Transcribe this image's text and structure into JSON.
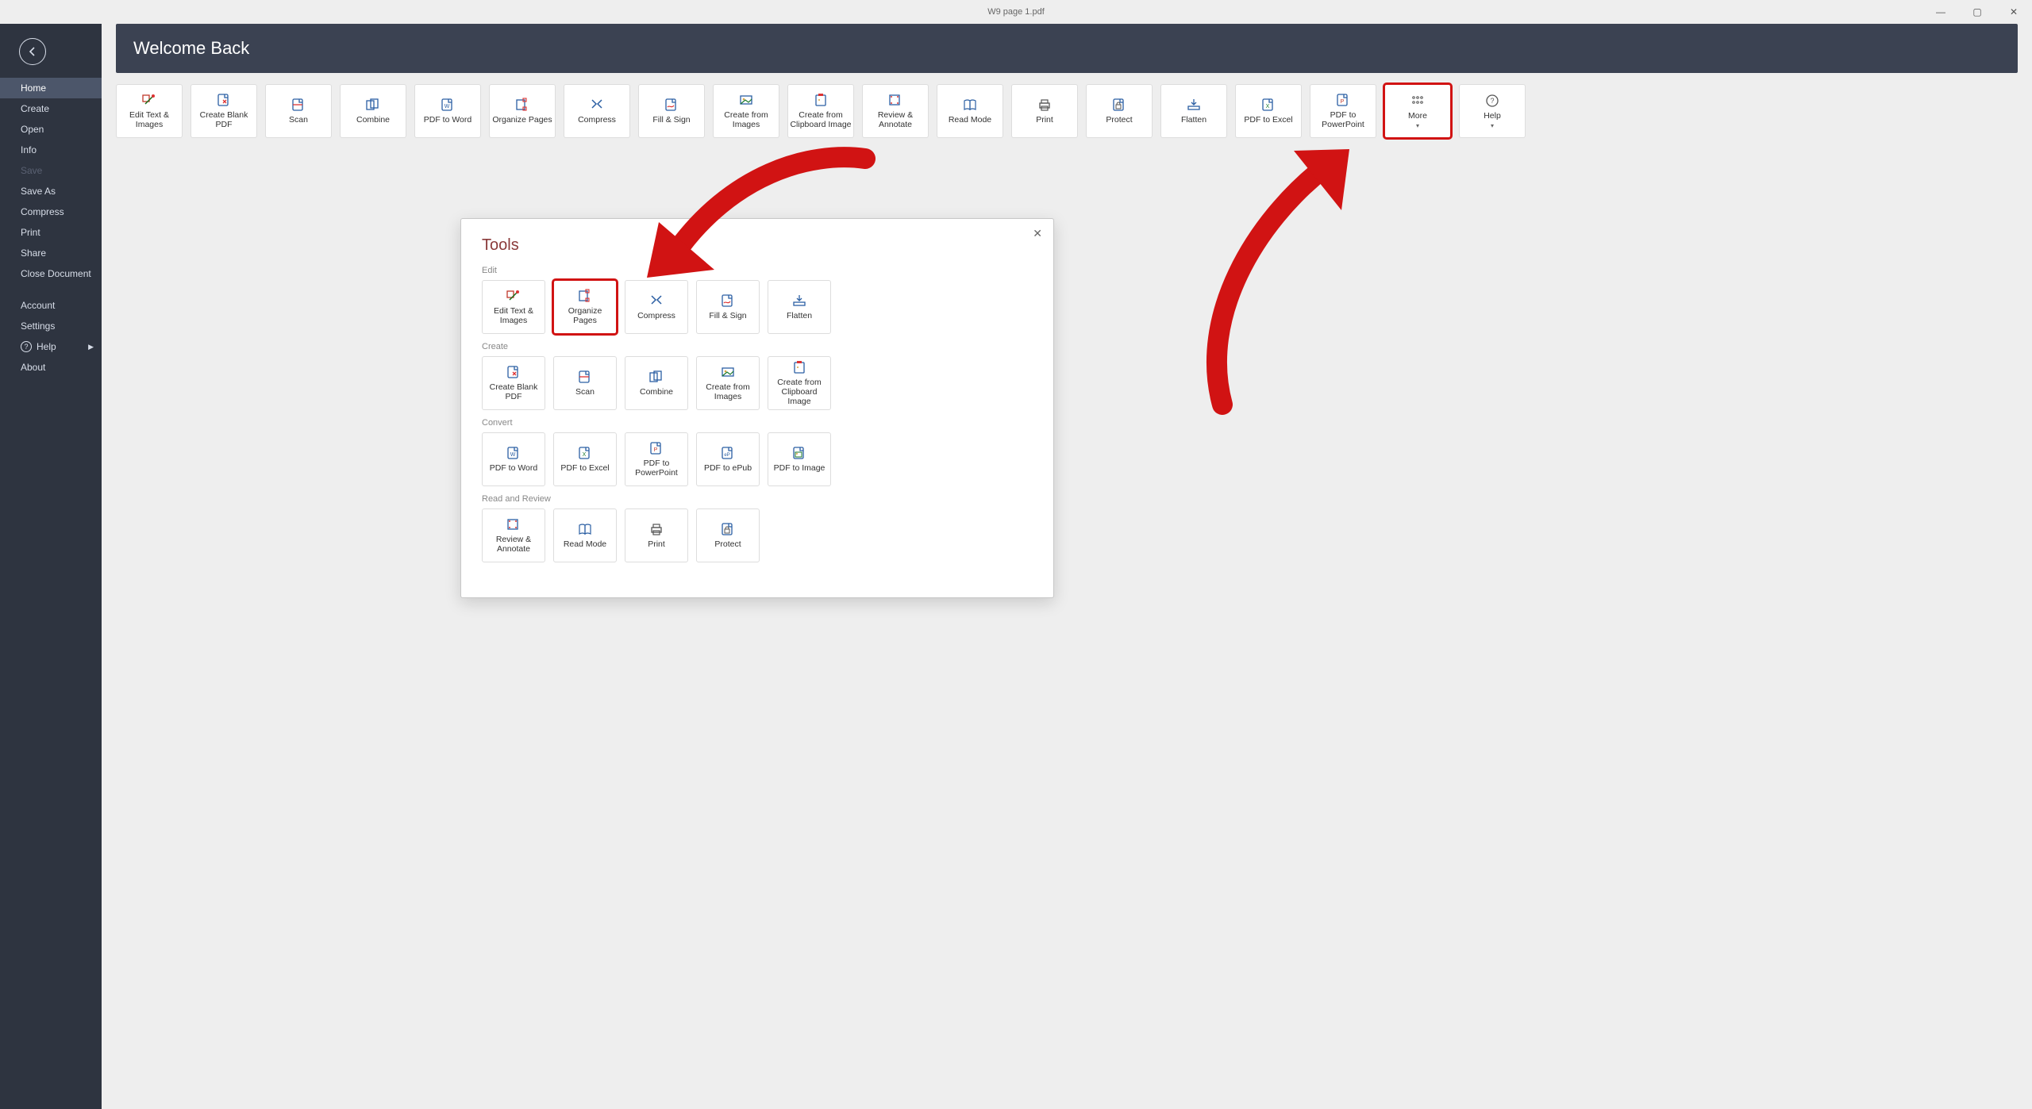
{
  "titlebar": {
    "document_title": "W9 page 1.pdf"
  },
  "window_controls": {
    "minimize": "—",
    "maximize": "▢",
    "close": "✕"
  },
  "sidebar": {
    "items": [
      {
        "label": "Home",
        "active": true
      },
      {
        "label": "Create"
      },
      {
        "label": "Open"
      },
      {
        "label": "Info"
      },
      {
        "label": "Save",
        "disabled": true
      },
      {
        "label": "Save As"
      },
      {
        "label": "Compress"
      },
      {
        "label": "Print"
      },
      {
        "label": "Share"
      },
      {
        "label": "Close Document"
      }
    ],
    "footer": [
      {
        "label": "Account"
      },
      {
        "label": "Settings"
      },
      {
        "label": "Help",
        "has_help_icon": true,
        "has_submenu": true
      },
      {
        "label": "About"
      }
    ]
  },
  "banner": {
    "title": "Welcome Back"
  },
  "toolbar": {
    "tiles": [
      {
        "label": "Edit Text & Images",
        "icon": "edit-text-images-icon"
      },
      {
        "label": "Create Blank PDF",
        "icon": "create-blank-pdf-icon"
      },
      {
        "label": "Scan",
        "icon": "scan-icon"
      },
      {
        "label": "Combine",
        "icon": "combine-icon"
      },
      {
        "label": "PDF to Word",
        "icon": "pdf-to-word-icon"
      },
      {
        "label": "Organize Pages",
        "icon": "organize-pages-icon"
      },
      {
        "label": "Compress",
        "icon": "compress-icon"
      },
      {
        "label": "Fill & Sign",
        "icon": "fill-sign-icon"
      },
      {
        "label": "Create from Images",
        "icon": "create-from-images-icon"
      },
      {
        "label": "Create from Clipboard Image",
        "icon": "create-from-clipboard-icon"
      },
      {
        "label": "Review & Annotate",
        "icon": "review-annotate-icon"
      },
      {
        "label": "Read Mode",
        "icon": "read-mode-icon"
      },
      {
        "label": "Print",
        "icon": "print-icon"
      },
      {
        "label": "Protect",
        "icon": "protect-icon"
      },
      {
        "label": "Flatten",
        "icon": "flatten-icon"
      },
      {
        "label": "PDF to Excel",
        "icon": "pdf-to-excel-icon"
      },
      {
        "label": "PDF to PowerPoint",
        "icon": "pdf-to-powerpoint-icon"
      },
      {
        "label": "More",
        "icon": "more-icon",
        "dropdown": true,
        "highlight": true
      },
      {
        "label": "Help",
        "icon": "help-icon",
        "dropdown": true
      }
    ]
  },
  "dialog": {
    "title": "Tools",
    "sections": [
      {
        "label": "Edit",
        "tiles": [
          {
            "label": "Edit Text & Images",
            "icon": "edit-text-images-icon"
          },
          {
            "label": "Organize Pages",
            "icon": "organize-pages-icon",
            "highlight": true
          },
          {
            "label": "Compress",
            "icon": "compress-icon"
          },
          {
            "label": "Fill & Sign",
            "icon": "fill-sign-icon"
          },
          {
            "label": "Flatten",
            "icon": "flatten-icon"
          }
        ]
      },
      {
        "label": "Create",
        "tiles": [
          {
            "label": "Create Blank PDF",
            "icon": "create-blank-pdf-icon"
          },
          {
            "label": "Scan",
            "icon": "scan-icon"
          },
          {
            "label": "Combine",
            "icon": "combine-icon"
          },
          {
            "label": "Create from Images",
            "icon": "create-from-images-icon"
          },
          {
            "label": "Create from Clipboard Image",
            "icon": "create-from-clipboard-icon"
          }
        ]
      },
      {
        "label": "Convert",
        "tiles": [
          {
            "label": "PDF to Word",
            "icon": "pdf-to-word-icon"
          },
          {
            "label": "PDF to Excel",
            "icon": "pdf-to-excel-icon"
          },
          {
            "label": "PDF to PowerPoint",
            "icon": "pdf-to-powerpoint-icon"
          },
          {
            "label": "PDF to ePub",
            "icon": "pdf-to-epub-icon"
          },
          {
            "label": "PDF to Image",
            "icon": "pdf-to-image-icon"
          }
        ]
      },
      {
        "label": "Read and Review",
        "tiles": [
          {
            "label": "Review & Annotate",
            "icon": "review-annotate-icon"
          },
          {
            "label": "Read Mode",
            "icon": "read-mode-icon"
          },
          {
            "label": "Print",
            "icon": "print-icon"
          },
          {
            "label": "Protect",
            "icon": "protect-icon"
          }
        ]
      }
    ]
  },
  "annotation": {
    "color": "#d11313"
  }
}
